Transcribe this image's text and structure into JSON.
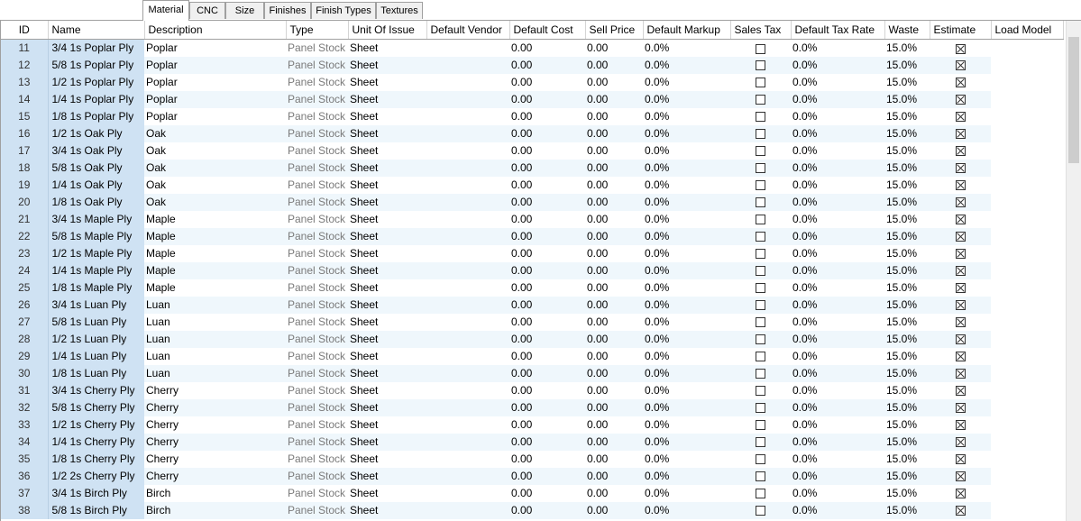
{
  "tabs": [
    {
      "label": "Material",
      "active": true
    },
    {
      "label": "CNC",
      "active": false
    },
    {
      "label": "Size",
      "active": false
    },
    {
      "label": "Finishes",
      "active": false
    },
    {
      "label": "Finish Types",
      "active": false
    },
    {
      "label": "Textures",
      "active": false
    }
  ],
  "columns": [
    "ID",
    "Name",
    "Description",
    "Type",
    "Unit Of Issue",
    "Default Vendor",
    "Default Cost",
    "Sell Price",
    "Default Markup",
    "Sales Tax",
    "Default Tax Rate",
    "Waste",
    "Estimate",
    "Load Model"
  ],
  "rows": [
    {
      "id": "11",
      "name": "3/4 1s Poplar Ply",
      "desc": "Poplar",
      "type": "Panel Stock",
      "unit": "Sheet",
      "vendor": "",
      "cost": "0.00",
      "sell": "0.00",
      "markup": "0.0%",
      "tax": false,
      "taxrate": "0.0%",
      "waste": "15.0%",
      "estimate": true,
      "model": ""
    },
    {
      "id": "12",
      "name": "5/8 1s Poplar Ply",
      "desc": "Poplar",
      "type": "Panel Stock",
      "unit": "Sheet",
      "vendor": "",
      "cost": "0.00",
      "sell": "0.00",
      "markup": "0.0%",
      "tax": false,
      "taxrate": "0.0%",
      "waste": "15.0%",
      "estimate": true,
      "model": ""
    },
    {
      "id": "13",
      "name": "1/2 1s Poplar Ply",
      "desc": "Poplar",
      "type": "Panel Stock",
      "unit": "Sheet",
      "vendor": "",
      "cost": "0.00",
      "sell": "0.00",
      "markup": "0.0%",
      "tax": false,
      "taxrate": "0.0%",
      "waste": "15.0%",
      "estimate": true,
      "model": ""
    },
    {
      "id": "14",
      "name": "1/4 1s Poplar Ply",
      "desc": "Poplar",
      "type": "Panel Stock",
      "unit": "Sheet",
      "vendor": "",
      "cost": "0.00",
      "sell": "0.00",
      "markup": "0.0%",
      "tax": false,
      "taxrate": "0.0%",
      "waste": "15.0%",
      "estimate": true,
      "model": ""
    },
    {
      "id": "15",
      "name": "1/8 1s Poplar Ply",
      "desc": "Poplar",
      "type": "Panel Stock",
      "unit": "Sheet",
      "vendor": "",
      "cost": "0.00",
      "sell": "0.00",
      "markup": "0.0%",
      "tax": false,
      "taxrate": "0.0%",
      "waste": "15.0%",
      "estimate": true,
      "model": ""
    },
    {
      "id": "16",
      "name": "1/2 1s Oak Ply",
      "desc": "Oak",
      "type": "Panel Stock",
      "unit": "Sheet",
      "vendor": "",
      "cost": "0.00",
      "sell": "0.00",
      "markup": "0.0%",
      "tax": false,
      "taxrate": "0.0%",
      "waste": "15.0%",
      "estimate": true,
      "model": ""
    },
    {
      "id": "17",
      "name": "3/4 1s Oak Ply",
      "desc": "Oak",
      "type": "Panel Stock",
      "unit": "Sheet",
      "vendor": "",
      "cost": "0.00",
      "sell": "0.00",
      "markup": "0.0%",
      "tax": false,
      "taxrate": "0.0%",
      "waste": "15.0%",
      "estimate": true,
      "model": ""
    },
    {
      "id": "18",
      "name": "5/8 1s Oak Ply",
      "desc": "Oak",
      "type": "Panel Stock",
      "unit": "Sheet",
      "vendor": "",
      "cost": "0.00",
      "sell": "0.00",
      "markup": "0.0%",
      "tax": false,
      "taxrate": "0.0%",
      "waste": "15.0%",
      "estimate": true,
      "model": ""
    },
    {
      "id": "19",
      "name": "1/4 1s Oak Ply",
      "desc": "Oak",
      "type": "Panel Stock",
      "unit": "Sheet",
      "vendor": "",
      "cost": "0.00",
      "sell": "0.00",
      "markup": "0.0%",
      "tax": false,
      "taxrate": "0.0%",
      "waste": "15.0%",
      "estimate": true,
      "model": ""
    },
    {
      "id": "20",
      "name": "1/8 1s Oak Ply",
      "desc": "Oak",
      "type": "Panel Stock",
      "unit": "Sheet",
      "vendor": "",
      "cost": "0.00",
      "sell": "0.00",
      "markup": "0.0%",
      "tax": false,
      "taxrate": "0.0%",
      "waste": "15.0%",
      "estimate": true,
      "model": ""
    },
    {
      "id": "21",
      "name": "3/4 1s Maple Ply",
      "desc": "Maple",
      "type": "Panel Stock",
      "unit": "Sheet",
      "vendor": "",
      "cost": "0.00",
      "sell": "0.00",
      "markup": "0.0%",
      "tax": false,
      "taxrate": "0.0%",
      "waste": "15.0%",
      "estimate": true,
      "model": ""
    },
    {
      "id": "22",
      "name": "5/8 1s Maple Ply",
      "desc": "Maple",
      "type": "Panel Stock",
      "unit": "Sheet",
      "vendor": "",
      "cost": "0.00",
      "sell": "0.00",
      "markup": "0.0%",
      "tax": false,
      "taxrate": "0.0%",
      "waste": "15.0%",
      "estimate": true,
      "model": ""
    },
    {
      "id": "23",
      "name": "1/2 1s Maple Ply",
      "desc": "Maple",
      "type": "Panel Stock",
      "unit": "Sheet",
      "vendor": "",
      "cost": "0.00",
      "sell": "0.00",
      "markup": "0.0%",
      "tax": false,
      "taxrate": "0.0%",
      "waste": "15.0%",
      "estimate": true,
      "model": ""
    },
    {
      "id": "24",
      "name": "1/4 1s Maple Ply",
      "desc": "Maple",
      "type": "Panel Stock",
      "unit": "Sheet",
      "vendor": "",
      "cost": "0.00",
      "sell": "0.00",
      "markup": "0.0%",
      "tax": false,
      "taxrate": "0.0%",
      "waste": "15.0%",
      "estimate": true,
      "model": ""
    },
    {
      "id": "25",
      "name": "1/8 1s Maple Ply",
      "desc": "Maple",
      "type": "Panel Stock",
      "unit": "Sheet",
      "vendor": "",
      "cost": "0.00",
      "sell": "0.00",
      "markup": "0.0%",
      "tax": false,
      "taxrate": "0.0%",
      "waste": "15.0%",
      "estimate": true,
      "model": ""
    },
    {
      "id": "26",
      "name": "3/4 1s Luan Ply",
      "desc": "Luan",
      "type": "Panel Stock",
      "unit": "Sheet",
      "vendor": "",
      "cost": "0.00",
      "sell": "0.00",
      "markup": "0.0%",
      "tax": false,
      "taxrate": "0.0%",
      "waste": "15.0%",
      "estimate": true,
      "model": ""
    },
    {
      "id": "27",
      "name": "5/8 1s Luan Ply",
      "desc": "Luan",
      "type": "Panel Stock",
      "unit": "Sheet",
      "vendor": "",
      "cost": "0.00",
      "sell": "0.00",
      "markup": "0.0%",
      "tax": false,
      "taxrate": "0.0%",
      "waste": "15.0%",
      "estimate": true,
      "model": ""
    },
    {
      "id": "28",
      "name": "1/2 1s Luan Ply",
      "desc": "Luan",
      "type": "Panel Stock",
      "unit": "Sheet",
      "vendor": "",
      "cost": "0.00",
      "sell": "0.00",
      "markup": "0.0%",
      "tax": false,
      "taxrate": "0.0%",
      "waste": "15.0%",
      "estimate": true,
      "model": ""
    },
    {
      "id": "29",
      "name": "1/4 1s Luan Ply",
      "desc": "Luan",
      "type": "Panel Stock",
      "unit": "Sheet",
      "vendor": "",
      "cost": "0.00",
      "sell": "0.00",
      "markup": "0.0%",
      "tax": false,
      "taxrate": "0.0%",
      "waste": "15.0%",
      "estimate": true,
      "model": ""
    },
    {
      "id": "30",
      "name": "1/8 1s Luan Ply",
      "desc": "Luan",
      "type": "Panel Stock",
      "unit": "Sheet",
      "vendor": "",
      "cost": "0.00",
      "sell": "0.00",
      "markup": "0.0%",
      "tax": false,
      "taxrate": "0.0%",
      "waste": "15.0%",
      "estimate": true,
      "model": ""
    },
    {
      "id": "31",
      "name": "3/4 1s Cherry Ply",
      "desc": "Cherry",
      "type": "Panel Stock",
      "unit": "Sheet",
      "vendor": "",
      "cost": "0.00",
      "sell": "0.00",
      "markup": "0.0%",
      "tax": false,
      "taxrate": "0.0%",
      "waste": "15.0%",
      "estimate": true,
      "model": ""
    },
    {
      "id": "32",
      "name": "5/8 1s Cherry Ply",
      "desc": "Cherry",
      "type": "Panel Stock",
      "unit": "Sheet",
      "vendor": "",
      "cost": "0.00",
      "sell": "0.00",
      "markup": "0.0%",
      "tax": false,
      "taxrate": "0.0%",
      "waste": "15.0%",
      "estimate": true,
      "model": ""
    },
    {
      "id": "33",
      "name": "1/2 1s Cherry Ply",
      "desc": "Cherry",
      "type": "Panel Stock",
      "unit": "Sheet",
      "vendor": "",
      "cost": "0.00",
      "sell": "0.00",
      "markup": "0.0%",
      "tax": false,
      "taxrate": "0.0%",
      "waste": "15.0%",
      "estimate": true,
      "model": ""
    },
    {
      "id": "34",
      "name": "1/4 1s Cherry Ply",
      "desc": "Cherry",
      "type": "Panel Stock",
      "unit": "Sheet",
      "vendor": "",
      "cost": "0.00",
      "sell": "0.00",
      "markup": "0.0%",
      "tax": false,
      "taxrate": "0.0%",
      "waste": "15.0%",
      "estimate": true,
      "model": ""
    },
    {
      "id": "35",
      "name": "1/8 1s Cherry Ply",
      "desc": "Cherry",
      "type": "Panel Stock",
      "unit": "Sheet",
      "vendor": "",
      "cost": "0.00",
      "sell": "0.00",
      "markup": "0.0%",
      "tax": false,
      "taxrate": "0.0%",
      "waste": "15.0%",
      "estimate": true,
      "model": ""
    },
    {
      "id": "36",
      "name": "1/2 2s Cherry Ply",
      "desc": "Cherry",
      "type": "Panel Stock",
      "unit": "Sheet",
      "vendor": "",
      "cost": "0.00",
      "sell": "0.00",
      "markup": "0.0%",
      "tax": false,
      "taxrate": "0.0%",
      "waste": "15.0%",
      "estimate": true,
      "model": ""
    },
    {
      "id": "37",
      "name": "3/4 1s Birch Ply",
      "desc": "Birch",
      "type": "Panel Stock",
      "unit": "Sheet",
      "vendor": "",
      "cost": "0.00",
      "sell": "0.00",
      "markup": "0.0%",
      "tax": false,
      "taxrate": "0.0%",
      "waste": "15.0%",
      "estimate": true,
      "model": ""
    },
    {
      "id": "38",
      "name": "5/8 1s Birch Ply",
      "desc": "Birch",
      "type": "Panel Stock",
      "unit": "Sheet",
      "vendor": "",
      "cost": "0.00",
      "sell": "0.00",
      "markup": "0.0%",
      "tax": false,
      "taxrate": "0.0%",
      "waste": "15.0%",
      "estimate": true,
      "model": ""
    }
  ],
  "colors": {
    "selection": "#cfe2f3",
    "alt_row": "#eff7fc",
    "type_text": "#7a7a7a"
  },
  "scrollbar": {
    "position_fraction": 0.0
  }
}
